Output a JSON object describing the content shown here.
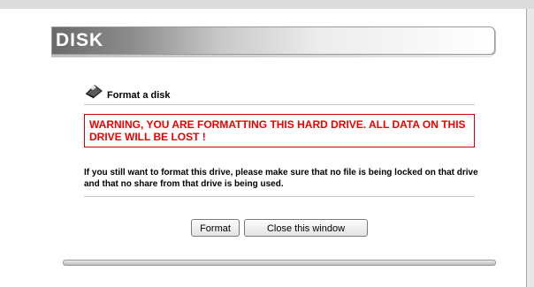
{
  "header": {
    "title": "DISK"
  },
  "section": {
    "label": "Format a disk",
    "icon": "disk-icon"
  },
  "warning": {
    "text": "WARNING, YOU ARE FORMATTING THIS HARD DRIVE. ALL DATA ON THIS DRIVE WILL BE LOST !",
    "color": "#ee0000"
  },
  "info": {
    "text": "If you still want to format this drive, please make sure that no file is being locked on that drive and that no share from that drive is being used."
  },
  "buttons": {
    "format_label": "Format",
    "close_label": "Close this window"
  }
}
